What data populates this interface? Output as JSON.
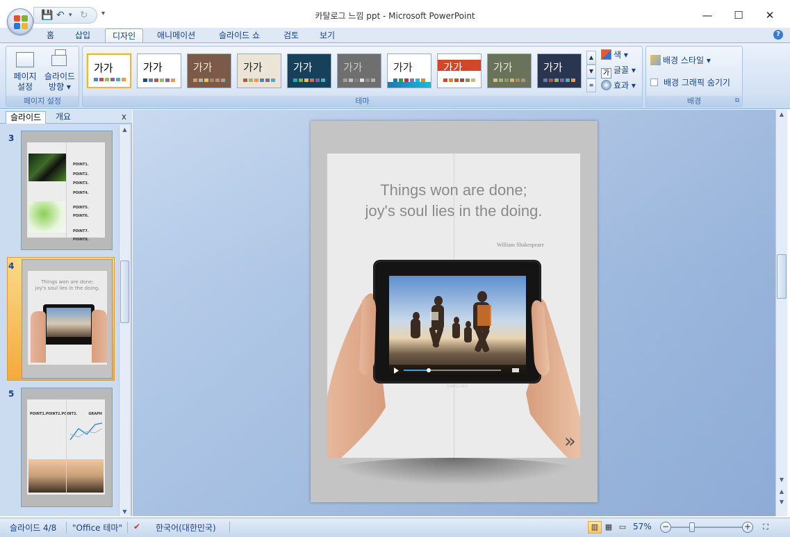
{
  "window": {
    "title": "카탈로그 느낌 ppt - Microsoft PowerPoint",
    "minimize": "—",
    "maximize": "☐",
    "close": "✕"
  },
  "qat": {
    "save": "💾",
    "undo": "↶",
    "undo_dropdown": "▾",
    "redo": "↻",
    "more": "▾"
  },
  "tabs": [
    {
      "label": "홈"
    },
    {
      "label": "삽입"
    },
    {
      "label": "디자인",
      "active": true
    },
    {
      "label": "애니메이션"
    },
    {
      "label": "슬라이드 쇼"
    },
    {
      "label": "검토"
    },
    {
      "label": "보기"
    }
  ],
  "help": "?",
  "ribbon": {
    "page_setup": {
      "group_label": "페이지 설정",
      "page_setup_label": "페이지\n설정",
      "orientation_label": "슬라이드\n방향 ▾"
    },
    "themes": {
      "group_label": "테마",
      "sample_text": "가가",
      "items": [
        {
          "bg": "#ffffff",
          "fg": "#000000",
          "selected": true,
          "dots": [
            "#4f81bd",
            "#c0504d",
            "#9bbb59",
            "#8064a2",
            "#4bacc6",
            "#f79646"
          ]
        },
        {
          "bg": "#ffffff",
          "fg": "#000000",
          "selected": false,
          "dots": [
            "#1f497d",
            "#4f81bd",
            "#c0504d",
            "#9bbb59",
            "#8064a2",
            "#f79646"
          ]
        },
        {
          "bg": "#7b5a4a",
          "fg": "#f5e6c8",
          "selected": false,
          "dots": [
            "#d49a6a",
            "#a2c0a8",
            "#e2c46a",
            "#9a8a6a",
            "#c48a6a",
            "#a0a0a0"
          ]
        },
        {
          "bg": "#ece4d6",
          "fg": "#222222",
          "selected": false,
          "dots": [
            "#c0504d",
            "#9bbb59",
            "#f79646",
            "#4f81bd",
            "#8064a2",
            "#4bacc6"
          ]
        },
        {
          "bg": "#17415a",
          "fg": "#ffffff",
          "selected": false,
          "dots": [
            "#33a2c7",
            "#7ab648",
            "#f2c233",
            "#e26d38",
            "#8f5ba0",
            "#4bacc6"
          ]
        },
        {
          "bg": "#6f6f6f",
          "fg": "#c9c9c9",
          "selected": false,
          "dots": [
            "#a0a0a0",
            "#c0c0c0",
            "#808080",
            "#e0e0e0",
            "#909090",
            "#b0b0b0"
          ]
        },
        {
          "bg": "#ffffff",
          "fg": "#222222",
          "selected": false,
          "dots": [
            "#1f77b4",
            "#2ca02c",
            "#d62728",
            "#9467bd",
            "#17becf",
            "#ff7f0e"
          ]
        },
        {
          "bg": "#ffffff",
          "fg": "#ffffff",
          "selected": false,
          "dots": [
            "#d24726",
            "#e48312",
            "#bd582c",
            "#865640",
            "#9b8357",
            "#c2bc80"
          ]
        },
        {
          "bg": "#6a735a",
          "fg": "#e8e8d8",
          "selected": false,
          "dots": [
            "#c9c28a",
            "#a3b57a",
            "#8a9a6a",
            "#d8b07a",
            "#b08a5a",
            "#9a9a8a"
          ]
        },
        {
          "bg": "#2a3550",
          "fg": "#ffffff",
          "selected": false,
          "dots": [
            "#4f81bd",
            "#c0504d",
            "#9bbb59",
            "#8064a2",
            "#4bacc6",
            "#f79646"
          ]
        }
      ],
      "colors_label": "색 ▾",
      "fonts_label": "글꼴 ▾",
      "effects_label": "효과 ▾"
    },
    "background": {
      "group_label": "배경",
      "styles_label": "배경 스타일 ▾",
      "hide_graphics_label": "배경 그래픽 숨기기",
      "hide_graphics_checked": false
    }
  },
  "panel": {
    "tab_slides": "슬라이드",
    "tab_outline": "개요",
    "close": "x",
    "thumbnails": [
      {
        "number": "3"
      },
      {
        "number": "4",
        "selected": true,
        "quote1": "Things won are done;",
        "quote2": "joy's soul lies in the doing."
      },
      {
        "number": "5"
      }
    ]
  },
  "slide": {
    "quote_line1": "Things won are done;",
    "quote_line2": "joy's soul lies in the doing.",
    "author": "William Shakespeare",
    "tablet_brand": "SAMSUNG",
    "next_arrow": "»"
  },
  "thumb3": {
    "points": [
      "POINT1.",
      "POINT2.",
      "POINT3.",
      "POINT4."
    ],
    "points_b": [
      "POINT5.",
      "POINT6.",
      "POINT7.",
      "POINT8."
    ]
  },
  "thumb5": {
    "header": "POINT1.POINT2.POINT3.",
    "graph": "GRAPH"
  },
  "status": {
    "slide_info": "슬라이드 4/8",
    "theme": "\"Office 테마\"",
    "language": "한국어(대한민국)",
    "zoom": "57%",
    "zoom_out": "−",
    "zoom_in": "+"
  }
}
